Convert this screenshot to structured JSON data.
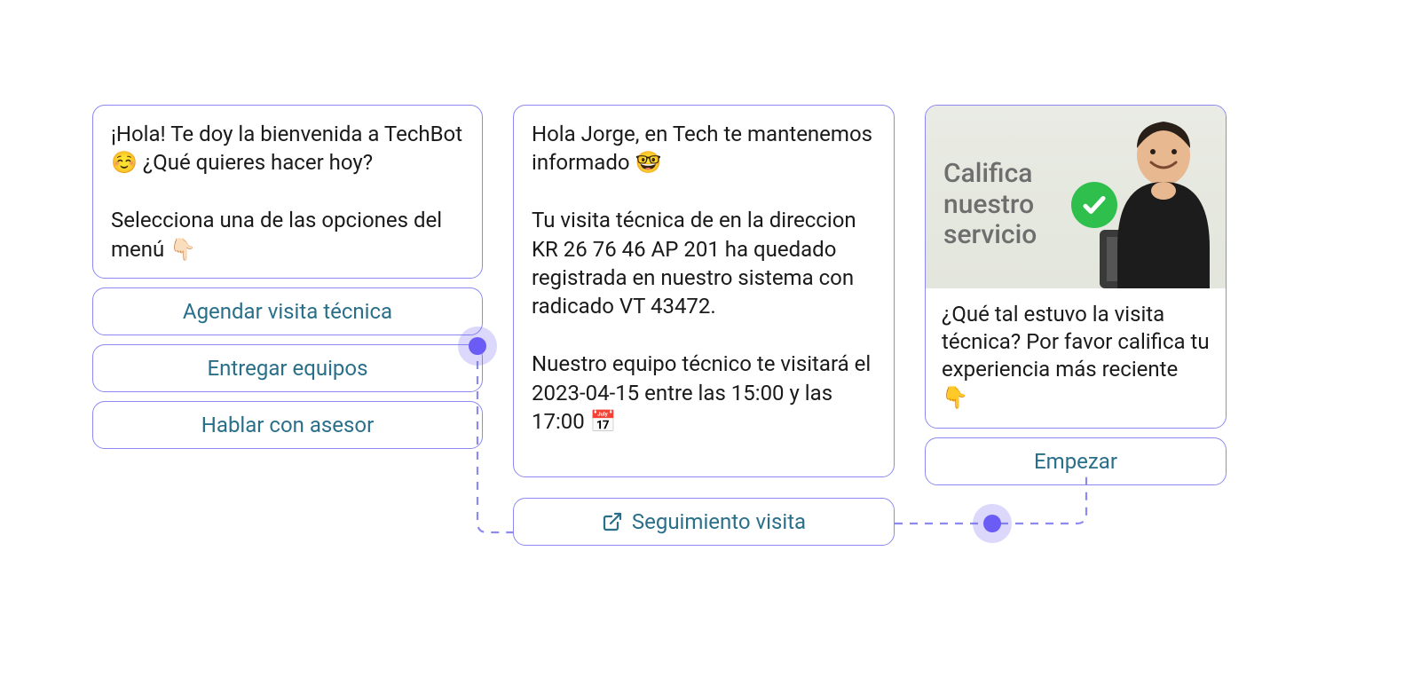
{
  "col1": {
    "greeting": "¡Hola! Te doy la bienvenida a TechBot ☺️ ¿Qué quieres hacer hoy?\n\nSelecciona una de las opciones del menú 👇🏻",
    "options": [
      "Agendar visita técnica",
      "Entregar equipos",
      "Hablar con asesor"
    ]
  },
  "col2": {
    "body": "Hola Jorge, en Tech te mantenemos informado 🤓\n\nTu visita técnica de en la direccion KR 26 76 46 AP 201 ha quedado registrada en nuestro sistema con radicado VT 43472.\n\nNuestro equipo técnico te visitará el 2023-04-15 entre las 15:00 y las 17:00 📅",
    "follow_label": "Seguimiento visita"
  },
  "col3": {
    "img_caption": "Califica\nnuestro\nservicio",
    "prompt": "¿Qué tal estuvo la visita técnica? Por favor califica tu experiencia más reciente 👇",
    "start_label": "Empezar"
  }
}
